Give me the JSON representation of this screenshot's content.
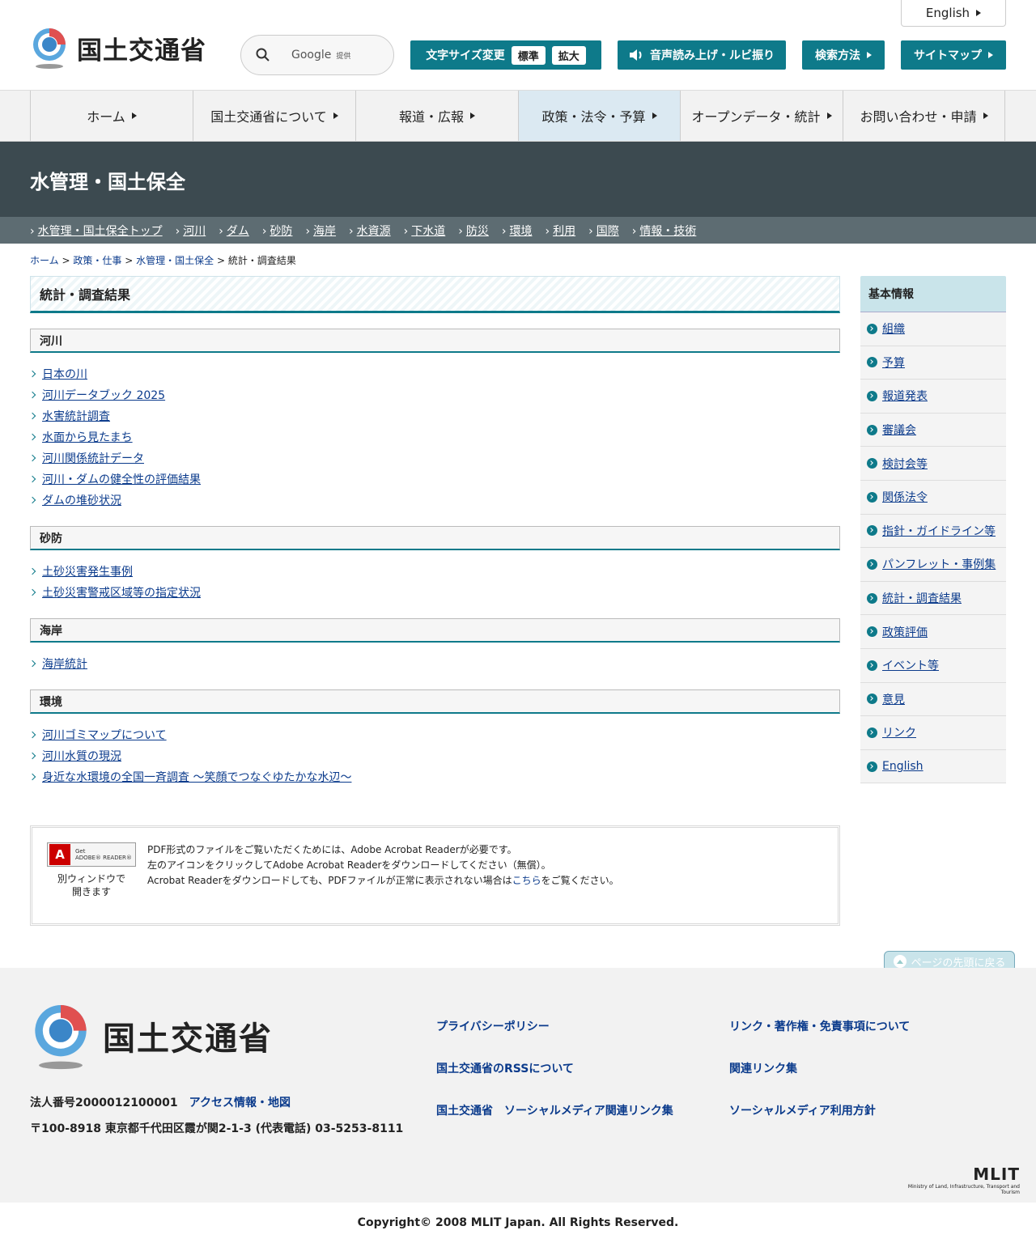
{
  "header": {
    "logo_text": "国土交通省",
    "lang_button": "English",
    "search_brand": "Google",
    "search_brand_sub": "提供",
    "font_size_label": "文字サイズ変更",
    "font_size_standard": "標準",
    "font_size_large": "拡大",
    "audio_label": "音声読み上げ・ルビ振り",
    "search_method": "検索方法",
    "sitemap": "サイトマップ"
  },
  "gnav": [
    "ホーム",
    "国土交通省について",
    "報道・広報",
    "政策・法令・予算",
    "オープンデータ・統計",
    "お問い合わせ・申請"
  ],
  "category": {
    "title": "水管理・国土保全",
    "subnav": [
      "水管理・国土保全トップ",
      "河川",
      "ダム",
      "砂防",
      "海岸",
      "水資源",
      "下水道",
      "防災",
      "環境",
      "利用",
      "国際",
      "情報・技術"
    ]
  },
  "breadcrumb": {
    "home": "ホーム",
    "policy": "政策・仕事",
    "water": "水管理・国土保全",
    "sep": ">",
    "current": "統計・調査結果"
  },
  "main": {
    "title": "統計・調査結果",
    "sections": [
      {
        "heading": "河川",
        "links": [
          "日本の川",
          "河川データブック 2025",
          "水害統計調査",
          "水面から見たまち",
          "河川関係統計データ",
          "河川・ダムの健全性の評価結果",
          "ダムの堆砂状況"
        ]
      },
      {
        "heading": "砂防",
        "links": [
          "土砂災害発生事例",
          "土砂災害警戒区域等の指定状況"
        ]
      },
      {
        "heading": "海岸",
        "links": [
          "海岸統計"
        ]
      },
      {
        "heading": "環境",
        "links": [
          "河川ゴミマップについて",
          "河川水質の現況",
          "身近な水環境の全国一斉調査 ～笑顔でつなぐゆたかな水辺～"
        ]
      }
    ]
  },
  "pdf": {
    "icon_line1": "Get",
    "icon_line2": "ADOBE® READER®",
    "caption_1": "別ウィンドウで",
    "caption_2": "開きます",
    "line1": "PDF形式のファイルをご覧いただくためには、Adobe Acrobat Readerが必要です。",
    "line2": "左のアイコンをクリックしてAdobe Acrobat Readerをダウンロードしてください（無償）。",
    "line3_pre": "Acrobat Readerをダウンロードしても、PDFファイルが正常に表示されない場合は",
    "line3_link": "こちら",
    "line3_post": "をご覧ください。"
  },
  "sidebar": {
    "heading": "基本情報",
    "items": [
      "組織",
      "予算",
      "報道発表",
      "審議会",
      "検討会等",
      "関係法令",
      "指針・ガイドライン等",
      "パンフレット・事例集",
      "統計・調査結果",
      "政策評価",
      "イベント等",
      "意見",
      "リンク",
      "English"
    ]
  },
  "pagetop": "ページの先頭に戻る",
  "footer": {
    "logo_text": "国土交通省",
    "corp_number": "法人番号2000012100001",
    "access": "アクセス情報・地図",
    "address": "〒100-8918 東京都千代田区霞が関2-1-3 (代表電話) 03-5253-8111",
    "links_left": [
      "プライバシーポリシー",
      "国土交通省のRSSについて",
      "国土交通省　ソーシャルメディア関連リンク集"
    ],
    "links_right": [
      "リンク・著作権・免責事項について",
      "関連リンク集",
      "ソーシャルメディア利用方針"
    ],
    "mlit": "MLIT",
    "mlit_sub": "Ministry of Land, Infrastructure, Transport and Tourism",
    "copyright": "Copyright© 2008 MLIT Japan. All Rights Reserved."
  },
  "colors": {
    "accent": "#0e7a8a",
    "category_band": "#3c4a50",
    "subnav": "#5d6c72",
    "link": "#0b3b8c"
  }
}
